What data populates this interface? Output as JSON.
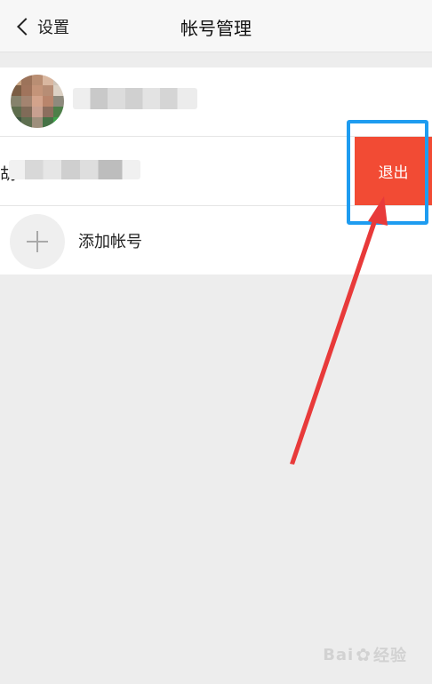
{
  "nav": {
    "back_label": "设置",
    "title": "帐号管理"
  },
  "accounts": [
    {
      "name_blurred": true
    },
    {
      "account_prefix": "胡",
      "swiped": true,
      "logout_label": "退出"
    }
  ],
  "add_account": {
    "label": "添加帐号"
  },
  "colors": {
    "logout_red": "#f24b34",
    "highlight_blue": "#1e9cf0",
    "arrow_red": "#e83a3a"
  },
  "watermark": {
    "text_left": "Bai",
    "text_right": "经验",
    "icon": "paw-icon"
  }
}
